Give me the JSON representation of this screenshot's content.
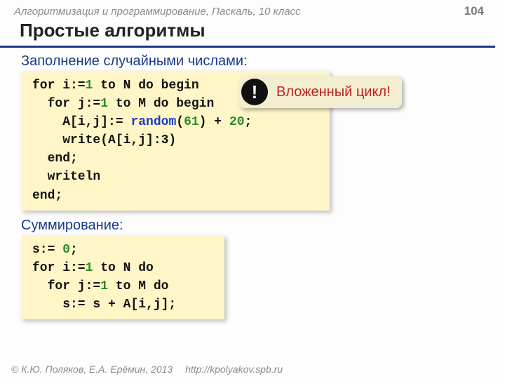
{
  "header": {
    "course": "Алгоритмизация и программирование, Паскаль, 10 класс",
    "page": "104"
  },
  "title": "Простые алгоритмы",
  "sections": {
    "fill": {
      "label": "Заполнение случайными числами:",
      "code": {
        "l1a": "for i:=",
        "l1b": "1",
        "l1c": " to N do begin",
        "l2a": "  for j:=",
        "l2b": "1",
        "l2c": " to M do begin",
        "l3a": "    A[i,j]:= ",
        "l3fn": "random",
        "l3b": "(",
        "l3n1": "61",
        "l3c": ") + ",
        "l3n2": "20",
        "l3d": ";",
        "l4": "    write(A[i,j]:3)",
        "l5": "  end;",
        "l6": "  writeln",
        "l7": "end;"
      }
    },
    "sum": {
      "label": "Суммирование:",
      "code": {
        "l1a": "s:= ",
        "l1b": "0",
        "l1c": ";",
        "l2a": "for i:=",
        "l2b": "1",
        "l2c": " to N do",
        "l3a": "  for j:=",
        "l3b": "1",
        "l3c": " to M do",
        "l4": "    s:= s + A[i,j];"
      }
    }
  },
  "callout": {
    "badge": "!",
    "text": "Вложенный цикл!"
  },
  "footer": {
    "copyright": "© К.Ю. Поляков, Е.А. Ерёмин, 2013",
    "link": "http://kpolyakov.spb.ru"
  }
}
